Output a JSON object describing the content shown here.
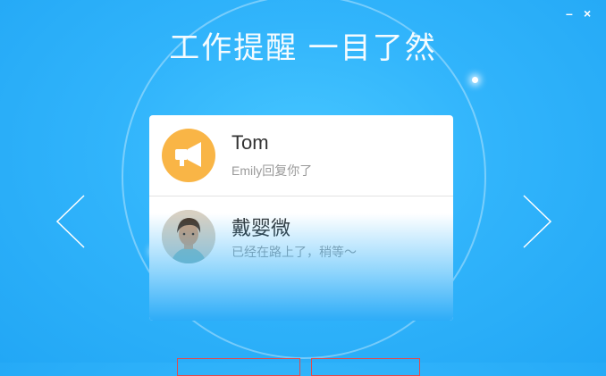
{
  "header": {
    "title": "工作提醒 一目了然",
    "minimize_label": "–",
    "close_label": "×"
  },
  "notifications": [
    {
      "name": "Tom",
      "message": "Emily回复你了",
      "avatar_icon": "megaphone-icon"
    },
    {
      "name": "戴婴微",
      "message": "已经在路上了，稍等～",
      "avatar_icon": "user-photo"
    }
  ],
  "navigation": {
    "prev_icon": "chevron-left-icon",
    "next_icon": "chevron-right-icon"
  },
  "colors": {
    "background": "#31b4fb",
    "accent": "#f9b546",
    "button_border": "#e24a4a"
  }
}
